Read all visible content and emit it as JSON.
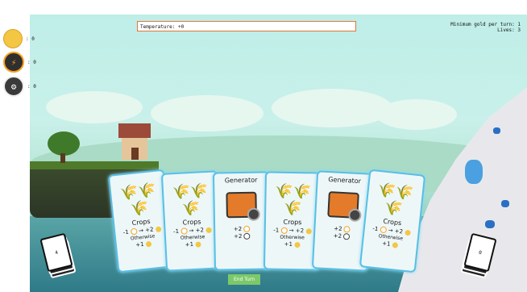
{
  "resources": {
    "gold": {
      "icon": "coin-icon",
      "value": ": 0"
    },
    "energy": {
      "icon": "lightning-icon",
      "value": ": 0"
    },
    "generators": {
      "icon": "generator-icon",
      "value": ": 0"
    }
  },
  "temperature_label": "Temperature: +0",
  "info": {
    "min_gold": "Minimum gold per turn: 1",
    "lives": "Lives: 3"
  },
  "cards": [
    {
      "title": "Crops",
      "type": "crops",
      "line1": "-1",
      "line1b": "→ +2",
      "otherwise": "Otherwise",
      "line3": "+1"
    },
    {
      "title": "Crops",
      "type": "crops",
      "line1": "-1",
      "line1b": "→ +2",
      "otherwise": "Otherwise",
      "line3": "+1"
    },
    {
      "title": "Generator",
      "type": "generator",
      "line1": "+2",
      "line1b": "",
      "otherwise": "",
      "line3": "+2"
    },
    {
      "title": "Crops",
      "type": "crops",
      "line1": "-1",
      "line1b": "→ +2",
      "otherwise": "Otherwise",
      "line3": "+1"
    },
    {
      "title": "Generator",
      "type": "generator",
      "line1": "+2",
      "line1b": "",
      "otherwise": "",
      "line3": "+2"
    },
    {
      "title": "Crops",
      "type": "crops",
      "line1": "-1",
      "line1b": "→ +2",
      "otherwise": "Otherwise",
      "line3": "+1"
    }
  ],
  "end_turn_label": "End Turn",
  "draw_pile": {
    "count": "4"
  },
  "discard_pile": {
    "count": "0"
  },
  "colors": {
    "card_border": "#58bfe5",
    "end_turn": "#7cc96a",
    "temperature_border": "#e0783a",
    "coin": "#f3c744"
  }
}
